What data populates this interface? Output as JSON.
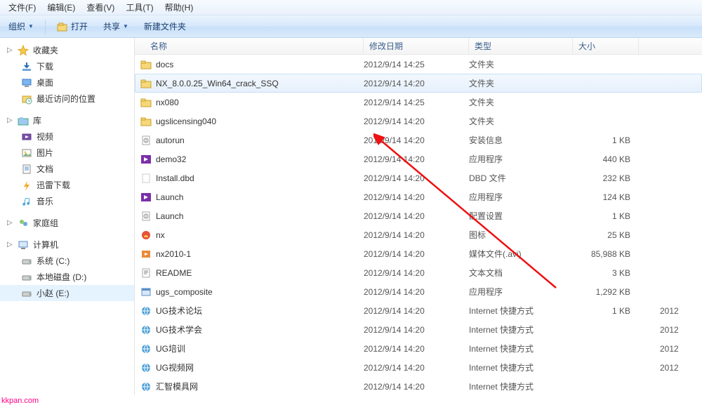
{
  "menubar": {
    "items": [
      {
        "label": "文件(F)"
      },
      {
        "label": "编辑(E)"
      },
      {
        "label": "查看(V)"
      },
      {
        "label": "工具(T)"
      },
      {
        "label": "帮助(H)"
      }
    ]
  },
  "toolbar": {
    "organize": "组织",
    "open": "打开",
    "share": "共享",
    "newfolder": "新建文件夹"
  },
  "sidebar": {
    "groups": [
      {
        "head": "收藏夹",
        "icon": "star",
        "items": [
          {
            "label": "下载",
            "icon": "download"
          },
          {
            "label": "桌面",
            "icon": "desktop"
          },
          {
            "label": "最近访问的位置",
            "icon": "recent"
          }
        ]
      },
      {
        "head": "库",
        "icon": "library",
        "items": [
          {
            "label": "视频",
            "icon": "video"
          },
          {
            "label": "图片",
            "icon": "picture"
          },
          {
            "label": "文档",
            "icon": "doc"
          },
          {
            "label": "迅雷下载",
            "icon": "xunlei"
          },
          {
            "label": "音乐",
            "icon": "music"
          }
        ]
      },
      {
        "head": "家庭组",
        "icon": "homegroup",
        "items": []
      },
      {
        "head": "计算机",
        "icon": "computer",
        "items": [
          {
            "label": "系统 (C:)",
            "icon": "drive"
          },
          {
            "label": "本地磁盘 (D:)",
            "icon": "drive"
          },
          {
            "label": "小赵 (E:)",
            "icon": "drive",
            "selected": true
          }
        ]
      }
    ]
  },
  "columns": {
    "name": "名称",
    "date": "修改日期",
    "type": "类型",
    "size": "大小"
  },
  "files": [
    {
      "name": "docs",
      "date": "2012/9/14 14:25",
      "type": "文件夹",
      "size": "",
      "icon": "folder"
    },
    {
      "name": "NX_8.0.0.25_Win64_crack_SSQ",
      "date": "2012/9/14 14:20",
      "type": "文件夹",
      "size": "",
      "icon": "folder",
      "selected": true
    },
    {
      "name": "nx080",
      "date": "2012/9/14 14:25",
      "type": "文件夹",
      "size": "",
      "icon": "folder"
    },
    {
      "name": "ugslicensing040",
      "date": "2012/9/14 14:20",
      "type": "文件夹",
      "size": "",
      "icon": "folder"
    },
    {
      "name": "autorun",
      "date": "2012/9/14 14:20",
      "type": "安装信息",
      "size": "1 KB",
      "icon": "inf"
    },
    {
      "name": "demo32",
      "date": "2012/9/14 14:20",
      "type": "应用程序",
      "size": "440 KB",
      "icon": "exe-purple"
    },
    {
      "name": "Install.dbd",
      "date": "2012/9/14 14:20",
      "type": "DBD 文件",
      "size": "232 KB",
      "icon": "blank"
    },
    {
      "name": "Launch",
      "date": "2012/9/14 14:20",
      "type": "应用程序",
      "size": "124 KB",
      "icon": "exe-purple"
    },
    {
      "name": "Launch",
      "date": "2012/9/14 14:20",
      "type": "配置设置",
      "size": "1 KB",
      "icon": "inf"
    },
    {
      "name": "nx",
      "date": "2012/9/14 14:20",
      "type": "图标",
      "size": "25 KB",
      "icon": "nx"
    },
    {
      "name": "nx2010-1",
      "date": "2012/9/14 14:20",
      "type": "媒体文件(.avi)",
      "size": "85,988 KB",
      "icon": "avi"
    },
    {
      "name": "README",
      "date": "2012/9/14 14:20",
      "type": "文本文档",
      "size": "3 KB",
      "icon": "txt"
    },
    {
      "name": "ugs_composite",
      "date": "2012/9/14 14:20",
      "type": "应用程序",
      "size": "1,292 KB",
      "icon": "exe"
    },
    {
      "name": "UG技术论坛",
      "date": "2012/9/14 14:20",
      "type": "Internet 快捷方式",
      "size": "1 KB",
      "icon": "url",
      "extra": "2012"
    },
    {
      "name": "UG技术学会",
      "date": "2012/9/14 14:20",
      "type": "Internet 快捷方式",
      "size": "",
      "icon": "url",
      "extra": "2012"
    },
    {
      "name": "UG培训",
      "date": "2012/9/14 14:20",
      "type": "Internet 快捷方式",
      "size": "",
      "icon": "url",
      "extra": "2012"
    },
    {
      "name": "UG视频网",
      "date": "2012/9/14 14:20",
      "type": "Internet 快捷方式",
      "size": "",
      "icon": "url",
      "extra": "2012"
    },
    {
      "name": "汇智模具网",
      "date": "2012/9/14 14:20",
      "type": "Internet 快捷方式",
      "size": "",
      "icon": "url"
    }
  ],
  "watermark": "kkpan.com"
}
